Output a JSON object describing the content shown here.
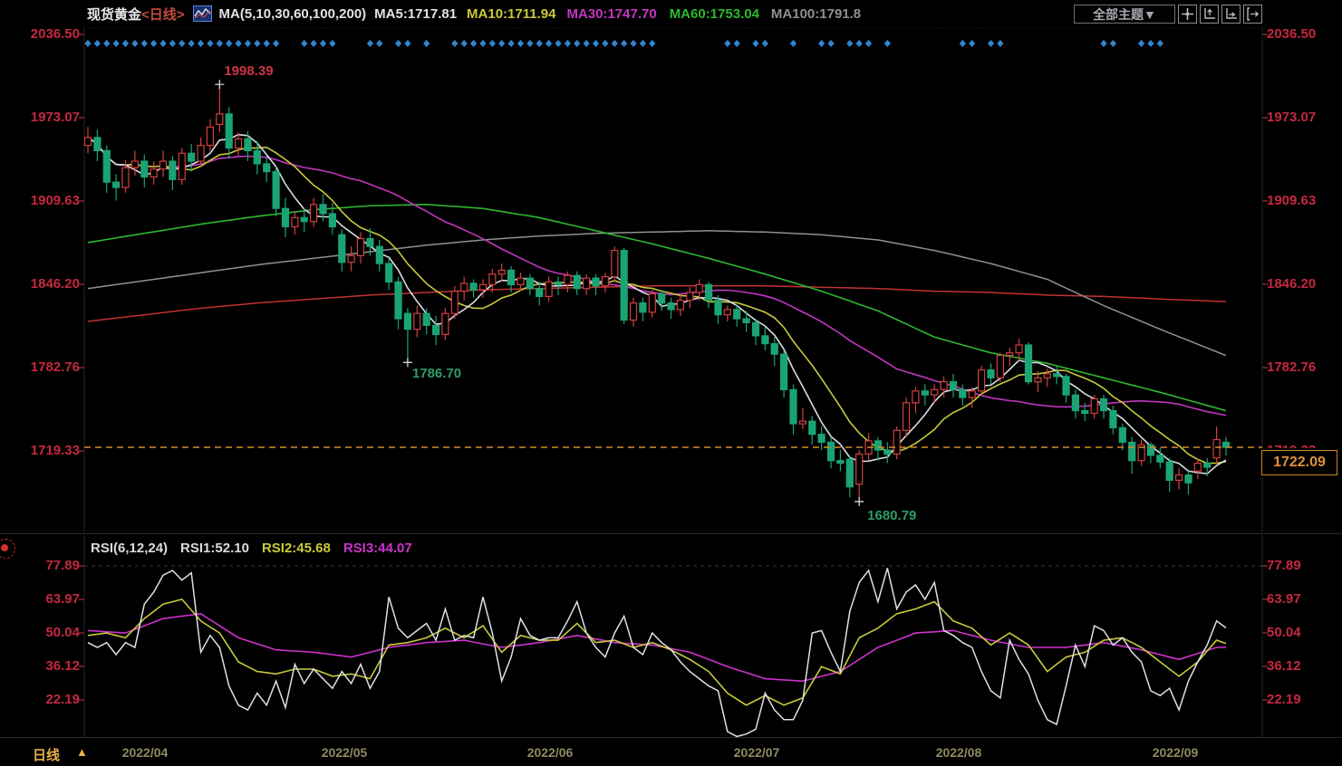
{
  "header": {
    "title": "现货黄金",
    "period_tag": "<日线>",
    "ma_settings": "MA(5,10,30,60,100,200)",
    "ma5": "MA5:1717.81",
    "ma10": "MA10:1711.94",
    "ma30": "MA30:1747.70",
    "ma60": "MA60:1753.04",
    "ma100": "MA100:1791.8",
    "theme_button": "全部主题▼"
  },
  "axes": {
    "price_labels": [
      "2036.50",
      "1973.07",
      "1909.63",
      "1846.20",
      "1782.76",
      "1719.33"
    ],
    "rsi_labels": [
      "77.89",
      "63.97",
      "50.04",
      "36.12",
      "22.19"
    ]
  },
  "rsi_header": {
    "name": "RSI(6,12,24)",
    "rsi1": "RSI1:52.10",
    "rsi2": "RSI2:45.68",
    "rsi3": "RSI3:44.07"
  },
  "footer": {
    "period_label": "日线",
    "arrow": "▲",
    "dates": [
      "2022/04",
      "2022/05",
      "2022/06",
      "2022/07",
      "2022/08",
      "2022/09"
    ]
  },
  "chart_data": {
    "type": "candlestick",
    "symbol": "现货黄金",
    "timeframe": "日线",
    "price_axis_values": [
      2036.5,
      1973.07,
      1909.63,
      1846.2,
      1782.76,
      1719.33
    ],
    "rsi_axis_values": [
      77.89,
      63.97,
      50.04,
      36.12,
      22.19
    ],
    "current_price": 1722.09,
    "current_price_label": "1722.09",
    "colors": {
      "up": "#d24040",
      "down": "#1aa474",
      "ma5": "#d9dde2",
      "ma10": "#c9c93a",
      "ma30": "#c136c1",
      "ma60": "#2db82d",
      "ma100": "#909090",
      "ma200": "#c23232",
      "axis_text": "#c5283f",
      "event_dot": "#2f86d0",
      "current_price": "#d78b2a",
      "rsi1": "#dde1e4",
      "rsi2": "#c9c93a",
      "rsi3": "#cc33cc",
      "annotation_high": "#cd3545",
      "annotation_low": "#2e9e68"
    },
    "ohlc": [
      [
        1952,
        1966,
        1946,
        1958
      ],
      [
        1958,
        1964,
        1940,
        1948
      ],
      [
        1948,
        1952,
        1916,
        1924
      ],
      [
        1924,
        1930,
        1910,
        1920
      ],
      [
        1920,
        1941,
        1916,
        1935
      ],
      [
        1935,
        1948,
        1929,
        1940
      ],
      [
        1940,
        1945,
        1920,
        1928
      ],
      [
        1928,
        1940,
        1922,
        1934
      ],
      [
        1934,
        1948,
        1928,
        1940
      ],
      [
        1940,
        1944,
        1918,
        1926
      ],
      [
        1926,
        1950,
        1922,
        1946
      ],
      [
        1946,
        1953,
        1932,
        1940
      ],
      [
        1940,
        1958,
        1936,
        1952
      ],
      [
        1952,
        1972,
        1948,
        1966
      ],
      [
        1968,
        1998.39,
        1962,
        1976
      ],
      [
        1976,
        1981,
        1942,
        1950
      ],
      [
        1950,
        1962,
        1944,
        1957
      ],
      [
        1957,
        1963,
        1940,
        1948
      ],
      [
        1948,
        1955,
        1930,
        1938
      ],
      [
        1938,
        1944,
        1924,
        1932
      ],
      [
        1932,
        1936,
        1898,
        1904
      ],
      [
        1904,
        1912,
        1882,
        1890
      ],
      [
        1890,
        1902,
        1884,
        1897
      ],
      [
        1897,
        1904,
        1886,
        1894
      ],
      [
        1894,
        1912,
        1890,
        1907
      ],
      [
        1907,
        1915,
        1894,
        1900
      ],
      [
        1900,
        1908,
        1884,
        1890
      ],
      [
        1884,
        1888,
        1856,
        1863
      ],
      [
        1863,
        1875,
        1856,
        1868
      ],
      [
        1868,
        1886,
        1862,
        1881
      ],
      [
        1881,
        1889,
        1868,
        1875
      ],
      [
        1875,
        1880,
        1856,
        1862
      ],
      [
        1862,
        1866,
        1842,
        1848
      ],
      [
        1848,
        1852,
        1812,
        1820
      ],
      [
        1824,
        1828,
        1786.7,
        1812
      ],
      [
        1812,
        1830,
        1806,
        1824
      ],
      [
        1824,
        1828,
        1808,
        1815
      ],
      [
        1815,
        1822,
        1800,
        1808
      ],
      [
        1808,
        1828,
        1804,
        1824
      ],
      [
        1824,
        1845,
        1820,
        1841
      ],
      [
        1841,
        1852,
        1834,
        1847
      ],
      [
        1847,
        1850,
        1836,
        1842
      ],
      [
        1842,
        1850,
        1836,
        1846
      ],
      [
        1846,
        1858,
        1840,
        1854
      ],
      [
        1854,
        1862,
        1848,
        1857
      ],
      [
        1857,
        1860,
        1840,
        1846
      ],
      [
        1846,
        1855,
        1841,
        1851
      ],
      [
        1851,
        1854,
        1838,
        1843
      ],
      [
        1843,
        1848,
        1830,
        1837
      ],
      [
        1837,
        1852,
        1833,
        1848
      ],
      [
        1848,
        1852,
        1838,
        1846
      ],
      [
        1846,
        1856,
        1840,
        1853
      ],
      [
        1853,
        1856,
        1838,
        1843
      ],
      [
        1843,
        1854,
        1838,
        1851
      ],
      [
        1851,
        1854,
        1838,
        1845
      ],
      [
        1845,
        1855,
        1840,
        1852
      ],
      [
        1852,
        1875,
        1848,
        1872
      ],
      [
        1872,
        1874,
        1816,
        1819
      ],
      [
        1819,
        1836,
        1814,
        1832
      ],
      [
        1832,
        1836,
        1818,
        1825
      ],
      [
        1825,
        1842,
        1821,
        1839
      ],
      [
        1839,
        1842,
        1826,
        1832
      ],
      [
        1832,
        1836,
        1820,
        1827
      ],
      [
        1827,
        1838,
        1822,
        1834
      ],
      [
        1834,
        1844,
        1828,
        1840
      ],
      [
        1840,
        1850,
        1834,
        1846
      ],
      [
        1846,
        1848,
        1828,
        1834
      ],
      [
        1834,
        1838,
        1816,
        1823
      ],
      [
        1823,
        1830,
        1818,
        1827
      ],
      [
        1827,
        1830,
        1814,
        1820
      ],
      [
        1820,
        1826,
        1810,
        1817
      ],
      [
        1817,
        1820,
        1800,
        1807
      ],
      [
        1807,
        1814,
        1796,
        1801
      ],
      [
        1801,
        1806,
        1784,
        1793
      ],
      [
        1793,
        1796,
        1760,
        1766
      ],
      [
        1766,
        1770,
        1732,
        1740
      ],
      [
        1740,
        1752,
        1736,
        1742
      ],
      [
        1742,
        1746,
        1724,
        1732
      ],
      [
        1732,
        1738,
        1720,
        1726
      ],
      [
        1726,
        1730,
        1706,
        1712
      ],
      [
        1712,
        1720,
        1704,
        1710
      ],
      [
        1713,
        1716,
        1684,
        1692
      ],
      [
        1694,
        1720,
        1680.79,
        1717
      ],
      [
        1717,
        1733,
        1712,
        1727
      ],
      [
        1727,
        1730,
        1712,
        1720
      ],
      [
        1720,
        1726,
        1710,
        1717
      ],
      [
        1717,
        1738,
        1713,
        1735
      ],
      [
        1735,
        1760,
        1730,
        1756
      ],
      [
        1756,
        1768,
        1748,
        1765
      ],
      [
        1765,
        1770,
        1754,
        1762
      ],
      [
        1762,
        1770,
        1756,
        1766
      ],
      [
        1766,
        1776,
        1760,
        1772
      ],
      [
        1772,
        1778,
        1760,
        1766
      ],
      [
        1766,
        1770,
        1754,
        1760
      ],
      [
        1760,
        1768,
        1752,
        1765
      ],
      [
        1765,
        1784,
        1762,
        1781
      ],
      [
        1781,
        1786,
        1770,
        1775
      ],
      [
        1775,
        1794,
        1772,
        1792
      ],
      [
        1792,
        1798,
        1784,
        1794
      ],
      [
        1794,
        1805,
        1788,
        1800
      ],
      [
        1800,
        1802,
        1770,
        1772
      ],
      [
        1772,
        1780,
        1764,
        1775
      ],
      [
        1775,
        1782,
        1768,
        1778
      ],
      [
        1778,
        1784,
        1770,
        1776
      ],
      [
        1776,
        1778,
        1756,
        1762
      ],
      [
        1762,
        1766,
        1744,
        1750
      ],
      [
        1750,
        1756,
        1742,
        1748
      ],
      [
        1748,
        1762,
        1744,
        1759
      ],
      [
        1759,
        1762,
        1744,
        1750
      ],
      [
        1750,
        1754,
        1732,
        1737
      ],
      [
        1737,
        1740,
        1720,
        1726
      ],
      [
        1726,
        1730,
        1702,
        1712
      ],
      [
        1712,
        1728,
        1708,
        1724
      ],
      [
        1724,
        1726,
        1710,
        1716
      ],
      [
        1716,
        1722,
        1706,
        1711
      ],
      [
        1711,
        1714,
        1688,
        1697
      ],
      [
        1697,
        1706,
        1690,
        1701
      ],
      [
        1701,
        1704,
        1686,
        1695
      ],
      [
        1704,
        1714,
        1698,
        1710
      ],
      [
        1710,
        1714,
        1700,
        1707
      ],
      [
        1714,
        1738,
        1710,
        1728
      ],
      [
        1726,
        1730,
        1716,
        1722.09
      ]
    ],
    "computed_ma_periods": [
      30,
      10,
      5
    ],
    "ma_sampled": {
      "sample_bars": [
        0,
        6,
        12,
        18,
        24,
        30,
        36,
        42,
        48,
        54,
        60,
        66,
        72,
        78,
        84,
        90,
        96,
        102,
        108,
        114,
        121
      ],
      "ma60": [
        1878,
        1885,
        1892,
        1898,
        1903,
        1906,
        1907,
        1904,
        1897,
        1887,
        1877,
        1866,
        1854,
        1841,
        1826,
        1806,
        1794,
        1786,
        1775,
        1764,
        1750
      ],
      "ma100": [
        1843,
        1849,
        1855,
        1861,
        1866,
        1871,
        1876,
        1880,
        1883,
        1885,
        1886,
        1887,
        1886,
        1884,
        1880,
        1872,
        1862,
        1850,
        1830,
        1812,
        1792
      ],
      "ma200": [
        1818,
        1823,
        1828,
        1832,
        1835,
        1838,
        1840,
        1842,
        1843,
        1844,
        1845,
        1845,
        1845,
        1844,
        1843,
        1841,
        1840,
        1838,
        1837,
        1835,
        1833
      ]
    },
    "rsi_series": {
      "rsi1_values": [
        46,
        44,
        46,
        41,
        46,
        44,
        62,
        67,
        74,
        76,
        72,
        75,
        42,
        49,
        44,
        28,
        20,
        18,
        25,
        20,
        30,
        19,
        37,
        29,
        35,
        31,
        27,
        34,
        29,
        37,
        27,
        34,
        65,
        52,
        48,
        51,
        54,
        47,
        60,
        47,
        49,
        48,
        65,
        50,
        30,
        40,
        56,
        49,
        47,
        48,
        48,
        55,
        63,
        50,
        44,
        40,
        50,
        57,
        44,
        41,
        50,
        46,
        43,
        38,
        34,
        31,
        28,
        26,
        9,
        7,
        8,
        10,
        25,
        18,
        14,
        14,
        22,
        50,
        51,
        42,
        34,
        59,
        71,
        76,
        63,
        77,
        60,
        67,
        70,
        64,
        71,
        51,
        49,
        46,
        44,
        34,
        26,
        23,
        47,
        39,
        33,
        22,
        14,
        12,
        28,
        45,
        36,
        53,
        51,
        45,
        48,
        42,
        38,
        26,
        24,
        27,
        18,
        30,
        38,
        45,
        55,
        52.1
      ],
      "rsi2_sample_bars": [
        0,
        2,
        4,
        6,
        8,
        10,
        12,
        14,
        16,
        18,
        20,
        22,
        24,
        26,
        28,
        30,
        32,
        34,
        36,
        38,
        40,
        42,
        44,
        46,
        48,
        50,
        52,
        54,
        56,
        58,
        60,
        62,
        64,
        66,
        68,
        70,
        72,
        74,
        76,
        78,
        80,
        82,
        84,
        86,
        88,
        90,
        92,
        94,
        96,
        98,
        100,
        102,
        104,
        106,
        108,
        110,
        112,
        114,
        116,
        118,
        120,
        121
      ],
      "rsi2_values": [
        49,
        50,
        48,
        56,
        62,
        64,
        55,
        50,
        38,
        34,
        33,
        35,
        35,
        32,
        33,
        31,
        45,
        46,
        48,
        52,
        48,
        53,
        42,
        49,
        47,
        47,
        54,
        46,
        47,
        44,
        46,
        43,
        39,
        34,
        25,
        20,
        24,
        20,
        23,
        36,
        33,
        48,
        52,
        58,
        60,
        63,
        55,
        52,
        45,
        50,
        45,
        34,
        40,
        42,
        47,
        48,
        44,
        38,
        32,
        38,
        47,
        45.68
      ],
      "rsi3_sample_bars": [
        0,
        4,
        8,
        12,
        16,
        20,
        24,
        28,
        32,
        36,
        40,
        44,
        48,
        52,
        56,
        60,
        64,
        68,
        72,
        76,
        80,
        84,
        88,
        92,
        96,
        100,
        104,
        108,
        112,
        116,
        120,
        121
      ],
      "rsi3_values": [
        51,
        50,
        56,
        58,
        48,
        43,
        42,
        40,
        44,
        46,
        47,
        44,
        46,
        49,
        46,
        45,
        42,
        36,
        31,
        30,
        34,
        44,
        50,
        51,
        47,
        44,
        44,
        46,
        43,
        39,
        44,
        44.07
      ]
    },
    "annotations": {
      "peak": {
        "text": "1998.39",
        "bar": 14,
        "value": 1998.39
      },
      "may_low": {
        "text": "1786.70",
        "bar": 34,
        "value": 1786.7
      },
      "july_low": {
        "text": "1680.79",
        "bar": 82,
        "value": 1680.79
      }
    },
    "event_dot_bars": [
      0,
      1,
      2,
      3,
      4,
      5,
      6,
      7,
      8,
      9,
      10,
      11,
      12,
      13,
      14,
      15,
      16,
      17,
      18,
      19,
      20,
      23,
      24,
      25,
      26,
      30,
      31,
      33,
      34,
      36,
      39,
      40,
      41,
      42,
      43,
      44,
      45,
      46,
      47,
      48,
      49,
      50,
      51,
      52,
      53,
      54,
      55,
      56,
      57,
      58,
      59,
      60,
      68,
      69,
      71,
      72,
      75,
      78,
      79,
      81,
      82,
      83,
      85,
      93,
      94,
      96,
      97,
      108,
      109,
      112,
      113,
      114
    ]
  }
}
